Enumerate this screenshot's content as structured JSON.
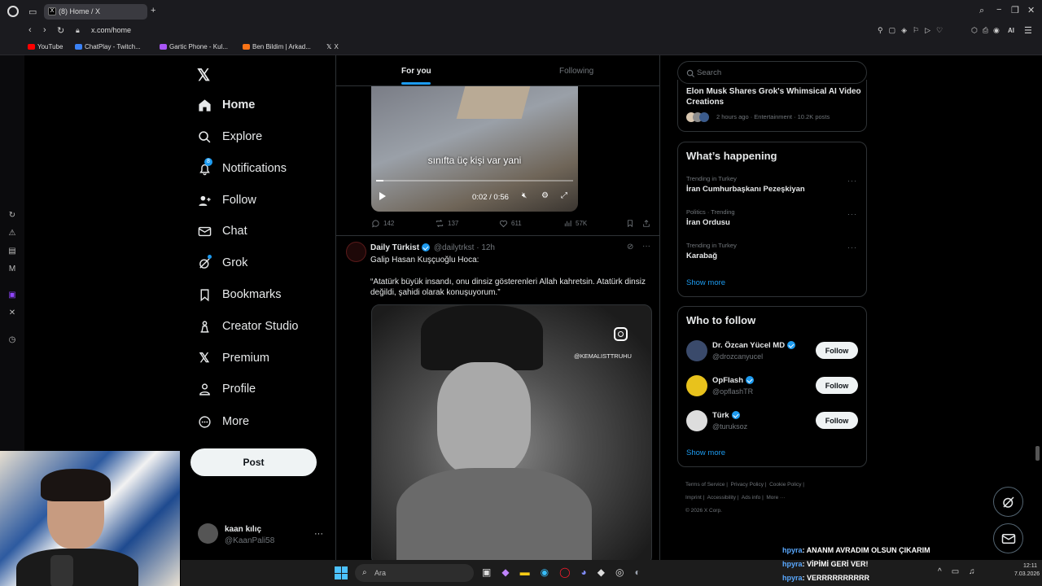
{
  "browser": {
    "tab_title": "(8) Home / X",
    "tab_favicon": "X",
    "url": "x.com/home",
    "bookmarks": [
      {
        "label": "YouTube",
        "color": "#ff0000"
      },
      {
        "label": "ChatPlay - Twitch...",
        "color": "#3b82f6"
      },
      {
        "label": "Gartic Phone - Kul...",
        "color": "#a855f7"
      },
      {
        "label": "Ben Bildim | Arkad...",
        "color": "#f97316"
      },
      {
        "label": "X",
        "color": "#ffffff"
      }
    ],
    "ai_label": "AI"
  },
  "nav": {
    "items": [
      {
        "label": "Home",
        "icon": "home-icon",
        "active": true
      },
      {
        "label": "Explore",
        "icon": "search-icon"
      },
      {
        "label": "Notifications",
        "icon": "bell-icon",
        "badge": "8"
      },
      {
        "label": "Follow",
        "icon": "person-plus-icon"
      },
      {
        "label": "Chat",
        "icon": "envelope-icon"
      },
      {
        "label": "Grok",
        "icon": "grok-icon"
      },
      {
        "label": "Bookmarks",
        "icon": "bookmark-icon"
      },
      {
        "label": "Creator Studio",
        "icon": "creator-studio-icon"
      },
      {
        "label": "Premium",
        "icon": "x-logo-icon"
      },
      {
        "label": "Profile",
        "icon": "person-icon"
      },
      {
        "label": "More",
        "icon": "more-circle-icon"
      }
    ],
    "post_label": "Post",
    "account": {
      "name": "kaan kılıç",
      "handle": "@KaanPali58"
    }
  },
  "feed": {
    "tabs": [
      {
        "label": "For you",
        "active": true
      },
      {
        "label": "Following"
      }
    ],
    "video1": {
      "caption": "sınıfta üç kişi var yani",
      "time": "0:02 / 0:56",
      "progress": 0.036
    },
    "tweet1_actions": {
      "replies": "142",
      "reposts": "137",
      "likes": "611",
      "views": "57K"
    },
    "tweet2": {
      "name": "Daily Türkist",
      "handle": "@dailytrkst",
      "time": "12h",
      "line1": "Galip Hasan Kuşçuoğlu Hoca:",
      "line2": "“Atatürk büyük insandı, onu dinsiz gösterenleri Allah kahretsin. Atatürk dinsiz değildi, şahidi olarak konuşuyorum.”",
      "watermark": "@KEMALISTTRUHU"
    }
  },
  "right": {
    "search_placeholder": "Search",
    "top_news": {
      "title": "Elon Musk Shares Grok's Whimsical AI Video Creations",
      "meta": "2 hours ago · Entertainment · 10.2K posts"
    },
    "whats_happening": {
      "title": "What’s happening",
      "trends": [
        {
          "meta": "Trending in Turkey",
          "name": "İran Cumhurbaşkanı Pezeşkiyan"
        },
        {
          "meta": "Politics · Trending",
          "name": "İran Ordusu"
        },
        {
          "meta": "Trending in Turkey",
          "name": "Karabağ"
        }
      ],
      "show_more": "Show more"
    },
    "who_to_follow": {
      "title": "Who to follow",
      "people": [
        {
          "name": "Dr. Özcan Yücel MD",
          "handle": "@drozcanyucel",
          "button": "Follow",
          "avatar_color": "#3a4a6b"
        },
        {
          "name": "OpFlash",
          "handle": "@opflashTR",
          "button": "Follow",
          "avatar_color": "#e8c21c"
        },
        {
          "name": "Türk",
          "handle": "@turuksoz",
          "button": "Follow",
          "avatar_color": "#dddddd"
        }
      ],
      "show_more": "Show more"
    },
    "footer": {
      "links": [
        "Terms of Service",
        "Privacy Policy",
        "Cookie Policy",
        "Imprint",
        "Accessibility",
        "Ads info",
        "More ···"
      ],
      "copyright": "© 2026 X Corp."
    }
  },
  "taskbar": {
    "search_placeholder": "Ara",
    "clock_time": "12:11",
    "clock_date": "7.03.2026"
  },
  "chat_overlay": [
    {
      "user": "hpyra",
      "text": ": ANANM AVRADIM OLSUN ÇIKARIM"
    },
    {
      "user": "hpyra",
      "text": ": VİPİMİ GERİ VER!"
    },
    {
      "user": "hpyra",
      "text": ": VERRRRRRRRRR"
    }
  ]
}
